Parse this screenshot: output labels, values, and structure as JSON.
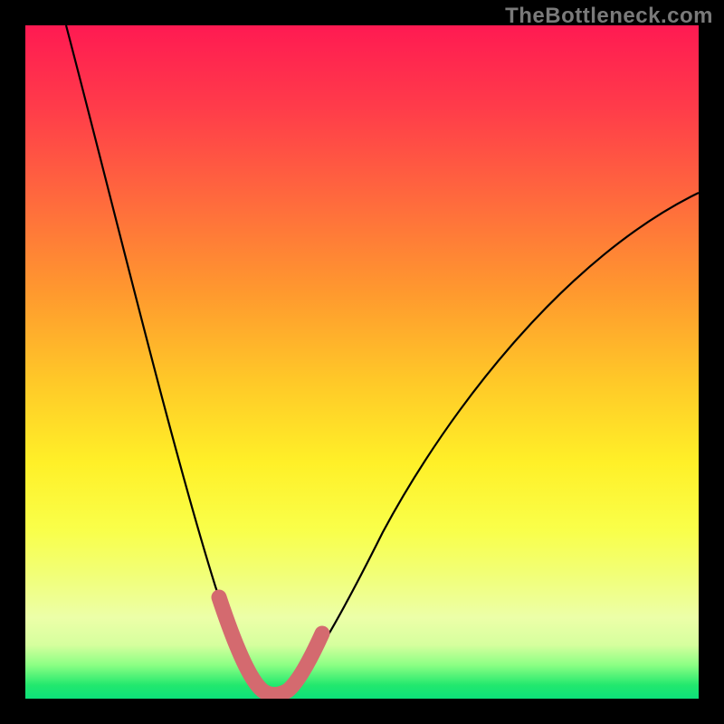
{
  "watermark": "TheBottleneck.com",
  "colors": {
    "frame_background": "#000000",
    "curve_stroke": "#000000",
    "highlight_stroke": "#d46a6f",
    "watermark_text": "#7a7a7a",
    "gradient_stops": [
      {
        "pos": 0.0,
        "hex": "#ff1a52"
      },
      {
        "pos": 0.12,
        "hex": "#ff3b4a"
      },
      {
        "pos": 0.26,
        "hex": "#ff6a3d"
      },
      {
        "pos": 0.4,
        "hex": "#ff9a2e"
      },
      {
        "pos": 0.53,
        "hex": "#ffc928"
      },
      {
        "pos": 0.65,
        "hex": "#fff028"
      },
      {
        "pos": 0.75,
        "hex": "#f9ff4a"
      },
      {
        "pos": 0.82,
        "hex": "#f1ff7a"
      },
      {
        "pos": 0.88,
        "hex": "#ecffa8"
      },
      {
        "pos": 0.92,
        "hex": "#d6ff9e"
      },
      {
        "pos": 0.95,
        "hex": "#8cff84"
      },
      {
        "pos": 0.98,
        "hex": "#22e86e"
      },
      {
        "pos": 1.0,
        "hex": "#0de07a"
      }
    ]
  },
  "chart_data": {
    "type": "line",
    "title": "",
    "xlabel": "",
    "ylabel": "",
    "xlim": [
      0,
      100
    ],
    "ylim": [
      0,
      100
    ],
    "grid": false,
    "legend": false,
    "series": [
      {
        "name": "bottleneck-curve",
        "color": "#000000",
        "x": [
          6,
          10,
          15,
          20,
          25,
          28,
          32,
          34,
          36,
          38,
          40,
          44,
          50,
          58,
          70,
          85,
          100
        ],
        "y": [
          100,
          80,
          60,
          42,
          25,
          15,
          5,
          2,
          1,
          2,
          5,
          15,
          28,
          45,
          62,
          72,
          75
        ]
      },
      {
        "name": "highlight-band",
        "color": "#d46a6f",
        "x": [
          29,
          31,
          33,
          35,
          37,
          39,
          42,
          44
        ],
        "y": [
          15,
          10,
          4,
          1,
          1,
          4,
          9,
          11
        ]
      }
    ],
    "annotations": []
  }
}
